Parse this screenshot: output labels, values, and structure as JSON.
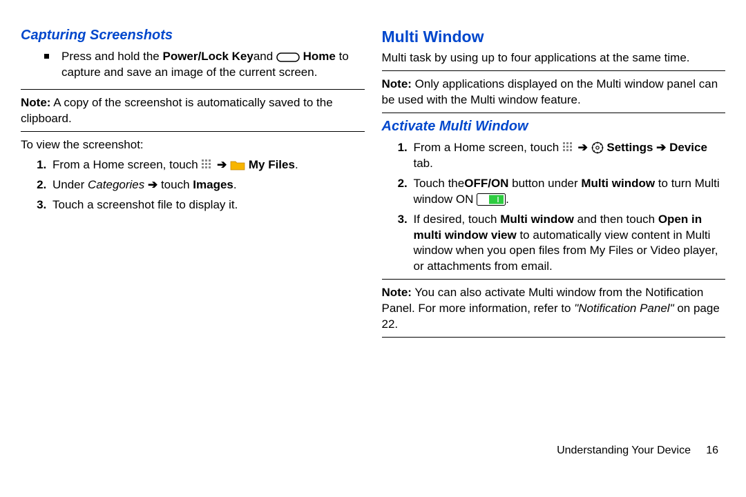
{
  "left": {
    "heading": "Capturing Screenshots",
    "bullet_pre": "Press and hold the ",
    "bullet_key": "Power/Lock Key",
    "bullet_and": "and ",
    "bullet_home": " Home",
    "bullet_line2": "to capture and save an image of the current screen.",
    "note_label": "Note:",
    "note_text": " A copy of the screenshot is automatically saved to the clipboard.",
    "view_label": "To view the screenshot:",
    "step1_a": "From a Home screen, touch ",
    "step1_b": " My Files",
    "step1_c": ".",
    "step2_a": "Under ",
    "step2_b": "Categories",
    "step2_c": " touch ",
    "step2_d": "Images",
    "step2_e": ".",
    "step3": "Touch a screenshot file to display it."
  },
  "right": {
    "heading": "Multi Window",
    "intro": "Multi task by using up to four applications at the same time.",
    "note1_label": "Note:",
    "note1_text": " Only applications displayed on the Multi window panel can be used with the Multi window feature.",
    "subheading": "Activate Multi Window",
    "s1_a": "From a Home screen, touch ",
    "s1_b": " Settings ",
    "s1_c": "Device",
    "s1_d": " tab.",
    "s2_a": "Touch the",
    "s2_b": "OFF/ON",
    "s2_c": "  button under ",
    "s2_d": "Multi window",
    "s2_e": " to turn Multi window ON ",
    "s2_f": ".",
    "s3_a": "If desired, touch ",
    "s3_b": "Multi window",
    "s3_c": " and then touch ",
    "s3_d": "Open in multi window view",
    "s3_e": " to automatically view content in Multi window when you open files from My Files or Video player, or attachments from email.",
    "note2_label": "Note:",
    "note2_a": " You can also activate Multi window from the Notification Panel. For more information, refer to ",
    "note2_b": "\"Notification Panel\"",
    "note2_c": " on page 22."
  },
  "footer_a": "Understanding Your Device",
  "footer_b": "16"
}
